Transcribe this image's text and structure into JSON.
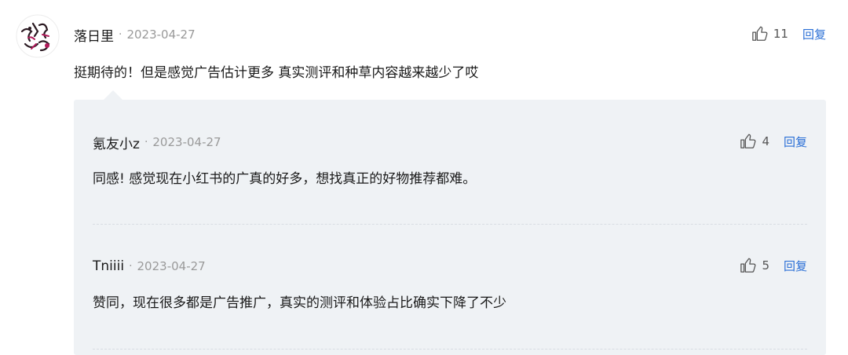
{
  "comment": {
    "author": "落日里",
    "date": "2023-04-27",
    "likes": "11",
    "reply_label": "回复",
    "text": "挺期待的！但是感觉广告估计更多 真实测评和种草内容越来越少了哎",
    "avatar_icon": "avatar-doodle-icon"
  },
  "replies": [
    {
      "author": "氪友小z",
      "date": "2023-04-27",
      "likes": "4",
      "reply_label": "回复",
      "text": "同感! 感觉现在小红书的广真的好多，想找真正的好物推荐都难。"
    },
    {
      "author": "Tniiii",
      "date": "2023-04-27",
      "likes": "5",
      "reply_label": "回复",
      "text": "赞同，现在很多都是广告推广，真实的测评和体验占比确实下降了不少"
    }
  ],
  "separator": "·",
  "colors": {
    "accent": "#2a6fd6",
    "reply_bg": "#eff2f5",
    "meta": "#9a9a9a"
  }
}
